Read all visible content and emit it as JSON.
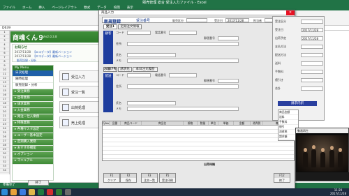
{
  "excel": {
    "title": "販売管理 総合 受注入力ファイル - Excel",
    "menu": [
      "ファイル",
      "ホーム",
      "挿入",
      "ページレイアウト",
      "数式",
      "データ",
      "校閲",
      "表示"
    ],
    "formula_ref": "D639",
    "status": "準備完了"
  },
  "app": {
    "logo": "商魂くん９",
    "version": "Ver2.0.3.8",
    "notice_title": "お知らせ",
    "notices": [
      {
        "date": "2017/11/28",
        "text": "【エコデータ】最新バージョン"
      },
      {
        "date": "2017/11/28",
        "text": "【エコデータ】最新バージョン"
      },
      {
        "date": "",
        "text": "販売記録・分析"
      }
    ],
    "menu_title": "My Menu",
    "menu_items": [
      {
        "label": "日次処理",
        "type": "sel"
      },
      {
        "label": "随時処理",
        "type": ""
      },
      {
        "label": "販売記録・分析",
        "type": ""
      },
      {
        "label": "受注業務",
        "type": "sec"
      },
      {
        "label": "出荷業務",
        "type": "sec"
      },
      {
        "label": "請求業務",
        "type": "sec"
      },
      {
        "label": "入金業務",
        "type": "sec"
      },
      {
        "label": "発注・仕入業務",
        "type": "sec"
      },
      {
        "label": "特殊業務",
        "type": "sec"
      },
      {
        "label": "各種マスタ設定",
        "type": "sec"
      },
      {
        "label": "ユーザー基本設定",
        "type": "sec"
      },
      {
        "label": "定期購入業務",
        "type": "sec"
      },
      {
        "label": "おすすめ機能",
        "type": "sec"
      },
      {
        "label": "オプション",
        "type": "sec"
      },
      {
        "label": "マニュアル",
        "type": "sec"
      }
    ],
    "tiles": [
      "受注入力",
      "受注一覧",
      "出荷処理",
      "売上処理"
    ],
    "exit_label": "終了"
  },
  "dialog": {
    "title": "商品入力",
    "close": "×",
    "head_new": "新規登録",
    "head_order": "受注番号",
    "head_labels": [
      "販売区分",
      "伝票番号",
      "受注日",
      "担当者"
    ],
    "order_date": "2017/11/28",
    "tabs_top": [
      "受注1",
      "定期注文情報"
    ],
    "customer_bar": "顧客",
    "labels_top": [
      "コード",
      "電話番号",
      "郵便番号",
      "住所",
      "氏名",
      "メモ"
    ],
    "tabs_mid": [
      "お届け先",
      "請求先",
      "本日注文履歴"
    ],
    "delivery_bar": "配送",
    "labels_mid": [
      "コード",
      "電話番号",
      "郵便番号",
      "住所",
      "氏名",
      "メモ"
    ],
    "grid_headers": [
      "行No",
      "品番",
      "商品コード",
      "商品名",
      "規格",
      "数量",
      "単位",
      "単価",
      "金額",
      "消費税",
      "備考"
    ],
    "ship_label": "出荷待機",
    "fkeys": [
      {
        "k": "F1",
        "l": "クリア"
      },
      {
        "k": "F2",
        "l": "保存"
      },
      {
        "k": "F3",
        "l": "注文一覧"
      },
      {
        "k": "F5",
        "l": "受注印刷"
      },
      {
        "k": "F12",
        "l": "終了"
      }
    ]
  },
  "right": {
    "labels": [
      "受注区分",
      "受注日",
      "出荷予定",
      "支払方法",
      "配送方法",
      "送料",
      "手数料",
      "値引き",
      "合計"
    ],
    "values": [
      "",
      "2017/11/28",
      "2017/11/28",
      "",
      "",
      "",
      "",
      "",
      ""
    ],
    "pink_bar": "請求内訳",
    "sum_rows": [
      "商品金額",
      "送料",
      "手数料",
      "値引",
      "消費税",
      "請求額"
    ]
  },
  "video": {
    "title": "動画再生"
  },
  "taskbar": {
    "time": "11:20",
    "date": "2017/11/28"
  }
}
